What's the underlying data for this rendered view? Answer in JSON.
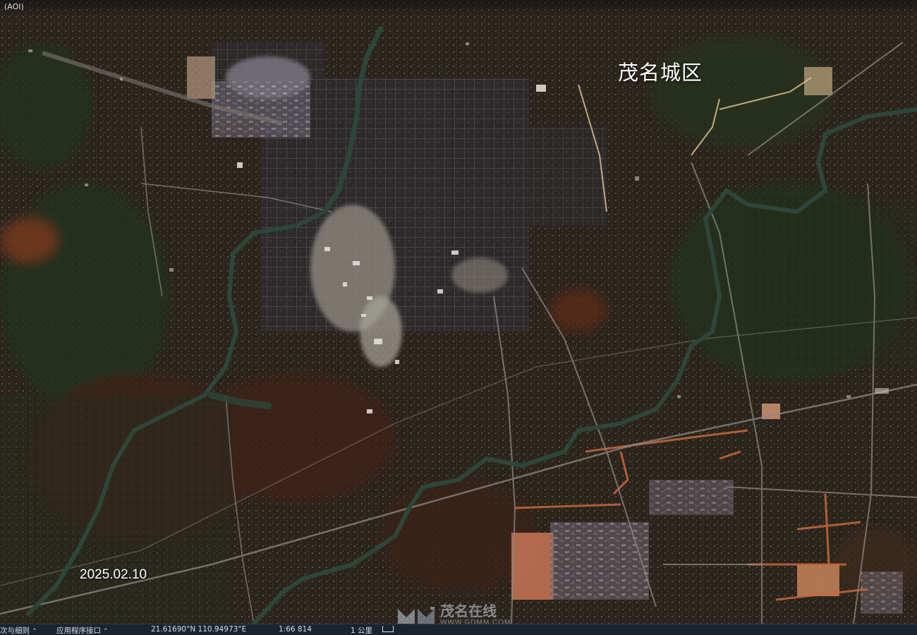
{
  "map": {
    "aoi_tag": "(AOI)",
    "area_label": "茂名城区",
    "date_label": "2025.02.10",
    "watermark_name": "茂名在线",
    "watermark_url": "WWW.GDMM.COM",
    "imagery": "satellite-true-color",
    "palette": {
      "base": "#2a231c",
      "vegetation": "#26301f",
      "urban": "#3a3a42",
      "bright_urban": "#c8c4b8",
      "bare_soil": "#8a4a2a",
      "construction": "#d9865a",
      "river": "#2f4a3a"
    }
  },
  "status_bar": {
    "left_link": "次与细则",
    "api_link": "应用程序接口",
    "coordinates": "21.61690°N 110.94973°E",
    "scale_ratio": "1:66 814",
    "scale_bar_label": "1 公里"
  }
}
